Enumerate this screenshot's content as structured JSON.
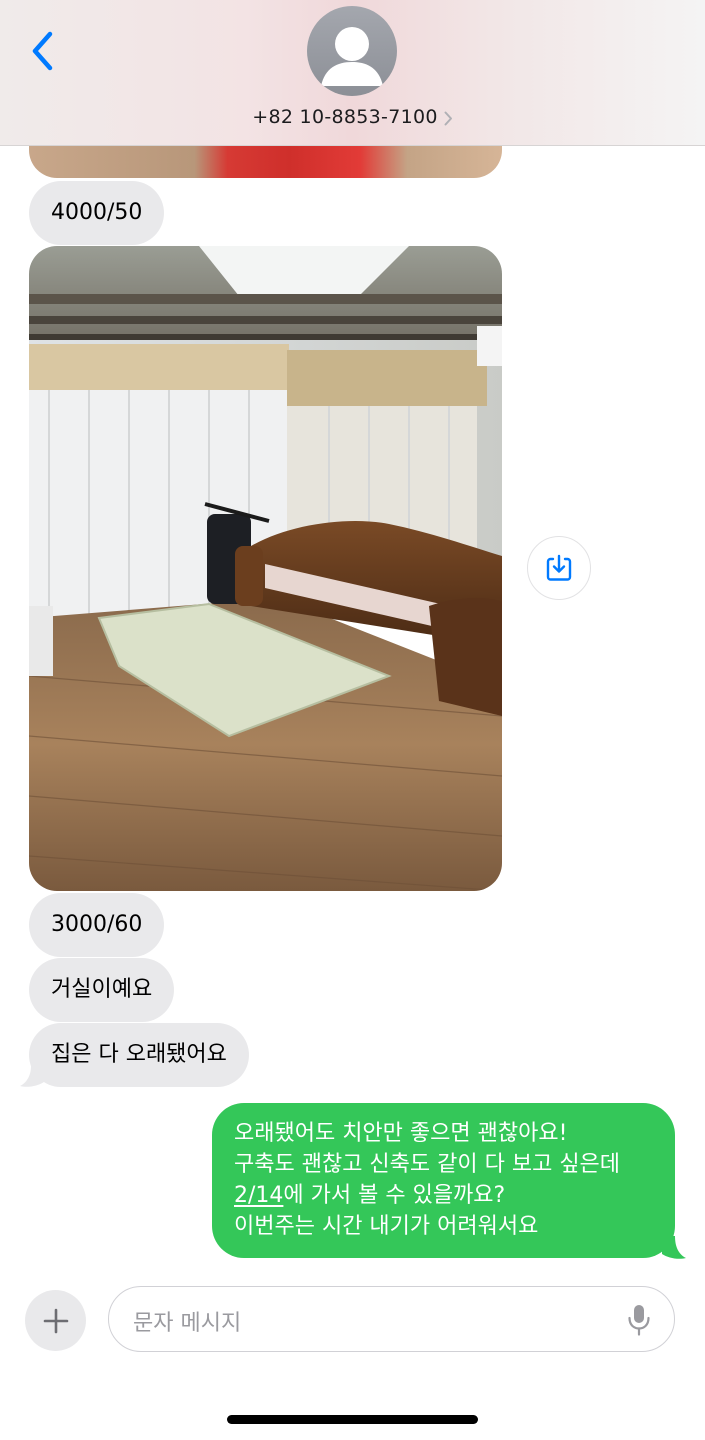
{
  "header": {
    "contact": "+82 10-8853-7100",
    "back_icon": "chevron-left-icon",
    "avatar_icon": "person-silhouette-icon"
  },
  "messages": {
    "price_1": "4000/50",
    "price_2": "3000/60",
    "text_living_room": "거실이예요",
    "text_old_house": "집은 다 오래됐어요"
  },
  "reply": {
    "line1": "오래됐어도 치안만 좋으면 괜찮아요!",
    "line2": "구축도 괜찮고 신축도 같이 다 보고 싶은데",
    "line3_date": "2/14",
    "line3_rest": "에 가서 볼 수 있을까요?",
    "line4": "이번주는 시간 내기가 어려워서요"
  },
  "composer": {
    "placeholder": "문자 메시지",
    "plus_icon": "plus-icon",
    "mic_icon": "microphone-icon"
  },
  "colors": {
    "accent_blue": "#007aff",
    "sent_bubble": "#34c759",
    "received_bubble": "#e9e9eb"
  }
}
